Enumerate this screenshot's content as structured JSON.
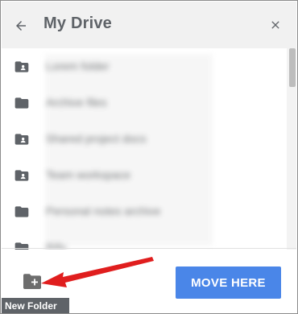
{
  "dialog": {
    "title": "My Drive",
    "back_icon": "arrow-left-icon",
    "close_icon": "close-icon"
  },
  "folders": [
    {
      "icon": "shared-folder-icon",
      "label": "Lorem folder"
    },
    {
      "icon": "folder-icon",
      "label": "Archive files"
    },
    {
      "icon": "shared-folder-icon",
      "label": "Shared project docs"
    },
    {
      "icon": "shared-folder-icon",
      "label": "Team workspace"
    },
    {
      "icon": "folder-icon",
      "label": "Personal notes archive"
    },
    {
      "icon": "folder-icon",
      "label": "Billy"
    }
  ],
  "footer": {
    "new_folder_icon": "new-folder-icon",
    "tooltip": "New Folder",
    "move_here_label": "MOVE HERE"
  },
  "colors": {
    "header_bg": "#f1f1f1",
    "primary_button": "#4a86e8",
    "icon_gray": "#5f6368",
    "annotation_arrow": "#e01e1e"
  }
}
